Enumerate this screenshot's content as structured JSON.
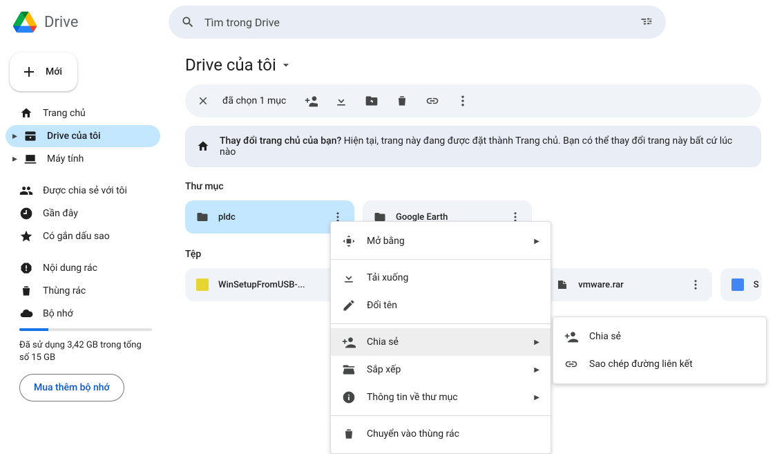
{
  "app": {
    "title": "Drive"
  },
  "search": {
    "placeholder": "Tìm trong Drive"
  },
  "sidebar": {
    "new_label": "Mới",
    "items": [
      {
        "label": "Trang chủ"
      },
      {
        "label": "Drive của tôi"
      },
      {
        "label": "Máy tính"
      },
      {
        "label": "Được chia sẻ với tôi"
      },
      {
        "label": "Gần đây"
      },
      {
        "label": "Có gắn dấu sao"
      },
      {
        "label": "Nội dung rác"
      },
      {
        "label": "Thùng rác"
      },
      {
        "label": "Bộ nhớ"
      }
    ],
    "storage_text": "Đã sử dụng 3,42 GB trong tổng số 15 GB",
    "buy_label": "Mua thêm bộ nhớ"
  },
  "breadcrumb": "Drive của tôi",
  "selection_bar": {
    "text": "đã chọn 1 mục"
  },
  "banner": {
    "question": "Thay đổi trang chủ của bạn?",
    "body": "Hiện tại, trang này đang được đặt thành Trang chủ. Bạn có thể thay đổi trang này bất cứ lúc nào"
  },
  "sections": {
    "folders": "Thư mục",
    "files": "Tệp"
  },
  "folders": [
    {
      "name": "pldc"
    },
    {
      "name": "Google Earth"
    }
  ],
  "files": [
    {
      "name": "WinSetupFromUSB-..."
    },
    {
      "name": "vmware.rar"
    },
    {
      "name": "S"
    }
  ],
  "context_menu": [
    {
      "label": "Mở bằng",
      "arrow": true
    },
    {
      "label": "Tải xuống"
    },
    {
      "label": "Đổi tên"
    },
    {
      "label": "Chia sẻ",
      "arrow": true
    },
    {
      "label": "Sắp xếp",
      "arrow": true
    },
    {
      "label": "Thông tin về thư mục",
      "arrow": true
    },
    {
      "label": "Chuyển vào thùng rác"
    }
  ],
  "submenu": [
    {
      "label": "Chia sẻ"
    },
    {
      "label": "Sao chép đường liên kết"
    }
  ]
}
